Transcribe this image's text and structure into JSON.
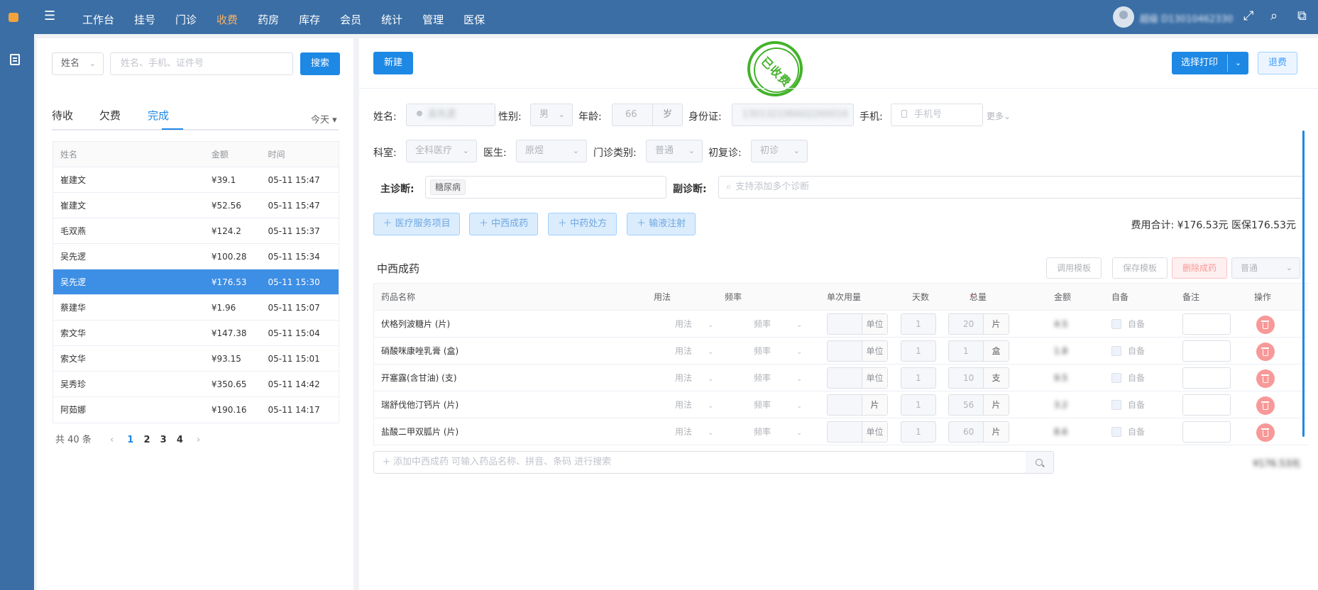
{
  "nav": {
    "items": [
      "工作台",
      "挂号",
      "门诊",
      "收费",
      "药房",
      "库存",
      "会员",
      "统计",
      "管理",
      "医保"
    ],
    "active_index": 3,
    "user_name": "超级 D13010462330"
  },
  "left": {
    "filter_label": "姓名",
    "search_placeholder": "姓名、手机、证件号",
    "search_button": "搜索",
    "tabs": [
      "待收",
      "欠费",
      "完成"
    ],
    "active_tab_index": 2,
    "date_filter": "今天",
    "table": {
      "headers": [
        "姓名",
        "金额",
        "时间"
      ],
      "rows": [
        {
          "name": "崔建文",
          "amount": "¥39.1",
          "time": "05-11 15:47"
        },
        {
          "name": "崔建文",
          "amount": "¥52.56",
          "time": "05-11 15:47"
        },
        {
          "name": "毛双燕",
          "amount": "¥124.2",
          "time": "05-11 15:37"
        },
        {
          "name": "吴先逻",
          "amount": "¥100.28",
          "time": "05-11 15:34"
        },
        {
          "name": "吴先逻",
          "amount": "¥176.53",
          "time": "05-11 15:30"
        },
        {
          "name": "蔡建华",
          "amount": "¥1.96",
          "time": "05-11 15:07"
        },
        {
          "name": "索文华",
          "amount": "¥147.38",
          "time": "05-11 15:04"
        },
        {
          "name": "索文华",
          "amount": "¥93.15",
          "time": "05-11 15:01"
        },
        {
          "name": "吴秀珍",
          "amount": "¥350.65",
          "time": "05-11 14:42"
        },
        {
          "name": "阿茹娜",
          "amount": "¥190.16",
          "time": "05-11 14:17"
        }
      ],
      "selected_index": 4
    },
    "pager": {
      "total": "共 40 条",
      "pages": [
        "1",
        "2",
        "3",
        "4"
      ],
      "active_page": 0
    }
  },
  "right": {
    "new_button": "新建",
    "stamp_text": "已收费",
    "print_button": "选择打印",
    "refund_button": "退费",
    "patient": {
      "name_label": "姓名:",
      "name_value": "吴先逻",
      "gender_label": "性别:",
      "gender_value": "男",
      "age_label": "年龄:",
      "age_value": "66",
      "age_unit": "岁",
      "id_label": "身份证:",
      "id_value": "130132196602260016",
      "phone_label": "手机:",
      "phone_placeholder": "手机号",
      "more_label": "更多"
    },
    "visit": {
      "dept_label": "科室:",
      "dept_value": "全科医疗",
      "doctor_label": "医生:",
      "doctor_value": "原煜",
      "type_label": "门诊类别:",
      "type_value": "普通",
      "first_label": "初复诊:",
      "first_value": "初诊",
      "main_diag_label": "主诊断:",
      "main_diag_tag": "糖尿病",
      "sub_diag_label": "副诊断:",
      "sub_diag_placeholder": "支持添加多个诊断"
    },
    "add_buttons": [
      "医疗服务项目",
      "中西成药",
      "中药处方",
      "输液注射"
    ],
    "fee_total": "费用合计: ¥176.53元  医保176.53元",
    "section": {
      "title": "中西成药",
      "buttons": {
        "use_template": "调用模板",
        "save_template": "保存模板",
        "delete": "删除成药",
        "type": "普通"
      }
    },
    "drug_table": {
      "headers": [
        "药品名称",
        "用法",
        "频率",
        "单次用量",
        "天数",
        "总量",
        "金额",
        "自备",
        "备注",
        "操作"
      ],
      "required_mark": "*",
      "usage_placeholder": "用法",
      "freq_placeholder": "频率",
      "self_label": "自备",
      "rows": [
        {
          "name": "伏格列波糖片 (片)",
          "dose_unit": "单位",
          "days": "1",
          "total": "20",
          "total_unit": "片",
          "amount": "4.5"
        },
        {
          "name": "硝酸咪康唑乳膏 (盒)",
          "dose_unit": "单位",
          "days": "1",
          "total": "1",
          "total_unit": "盒",
          "amount": "1.8"
        },
        {
          "name": "开塞露(含甘油) (支)",
          "dose_unit": "单位",
          "days": "1",
          "total": "10",
          "total_unit": "支",
          "amount": "9.5"
        },
        {
          "name": "瑞舒伐他汀钙片 (片)",
          "dose_unit": "片",
          "days": "1",
          "total": "56",
          "total_unit": "片",
          "amount": "3.2"
        },
        {
          "name": "盐酸二甲双胍片 (片)",
          "dose_unit": "单位",
          "days": "1",
          "total": "60",
          "total_unit": "片",
          "amount": "8.6"
        }
      ]
    },
    "add_drug_placeholder": "+ 添加中西成药 可输入药品名称、拼音、条码 进行搜索",
    "section_total": "¥176.53元"
  },
  "colors": {
    "topbar": "#3a6ea5",
    "primary": "#1e88e5",
    "active_nav": "#f7b267",
    "stamp": "#43b22b",
    "selected_row": "#3d8ee5"
  }
}
